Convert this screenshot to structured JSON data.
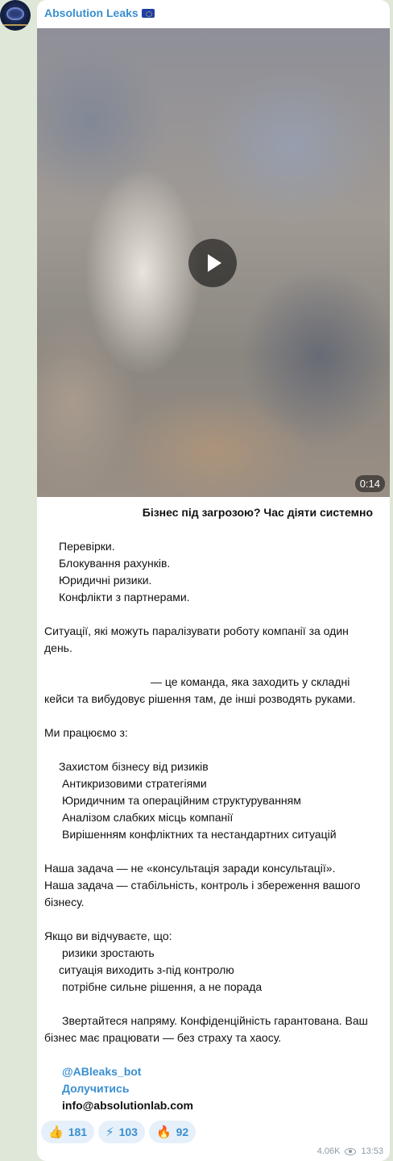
{
  "channel": {
    "name": "Absolution Leaks",
    "flag_icon": "eu-flag-icon"
  },
  "video": {
    "duration": "0:14",
    "play_icon": "play-icon"
  },
  "post": {
    "title": "Бізнес під загрозою? Час діяти системно",
    "issues": [
      "Перевірки.",
      "Блокування рахунків.",
      "Юридичні ризики.",
      "Конфлікти з партнерами."
    ],
    "situations": [
      "Ситуації, які можуть паралізувати роботу компанії за один",
      "день."
    ],
    "team": [
      "— це команда, яка заходить у складні",
      "кейси та вибудовує рішення там, де інші розводять руками."
    ],
    "work_heading": "Ми працюємо з:",
    "work_items": [
      "Захистом бізнесу від ризиків",
      "Антикризовими стратегіями",
      "Юридичним та операційним структуруванням",
      "Аналізом слабких місць компанії",
      "Вирішенням конфліктних та нестандартних ситуацій"
    ],
    "goal": [
      "Наша задача — не «консультація заради консультації».",
      "Наша задача — стабільність, контроль і збереження вашого",
      "бізнесу."
    ],
    "feel_heading": "Якщо ви відчуваєте, що:",
    "feel_items": [
      "ризики зростають",
      "ситуація виходить з-під контролю",
      "потрібне сильне рішення, а не порада"
    ],
    "closing": [
      "Звертайтеся напряму. Конфіденційність гарантована. Ваш",
      "бізнес має працювати — без страху та хаосу."
    ],
    "bot_link": "@ABleaks_bot",
    "join_link": "Долучитись",
    "email": "info@absolutionlab.com"
  },
  "reactions": [
    {
      "emoji": "👍",
      "count": "181",
      "icon": "thumbs-up-icon"
    },
    {
      "emoji": "⚡",
      "count": "103",
      "icon": "lightning-icon"
    },
    {
      "emoji": "🔥",
      "count": "92",
      "icon": "fire-icon"
    }
  ],
  "meta": {
    "views": "4.06K",
    "time": "13:53"
  }
}
